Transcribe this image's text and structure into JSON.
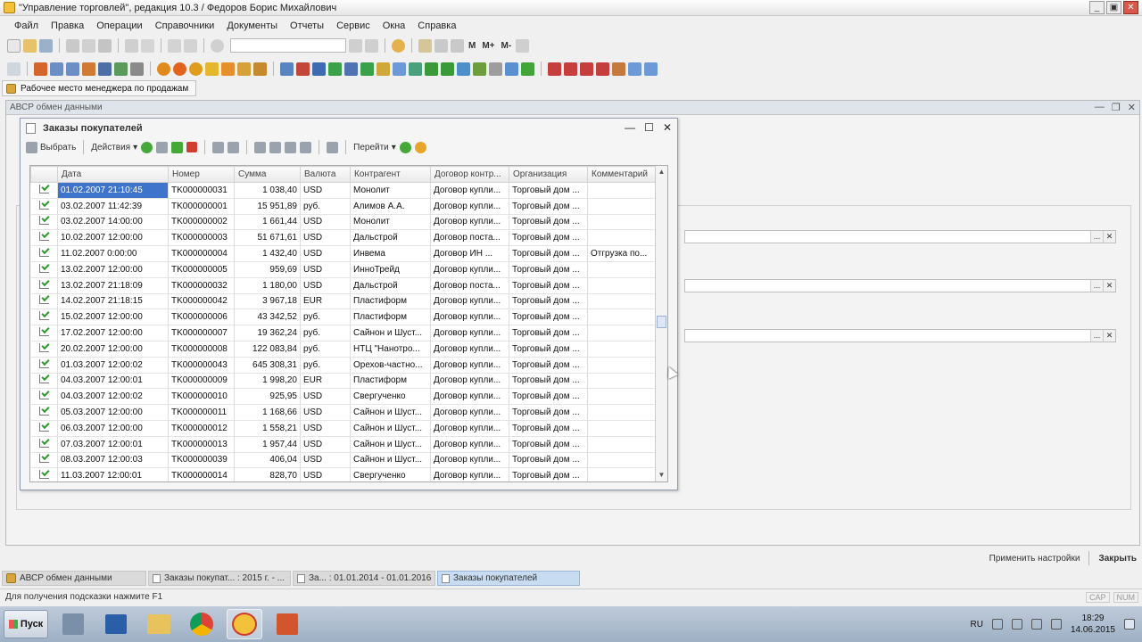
{
  "window": {
    "title": "\"Управление торговлей\", редакция 10.3 / Федоров Борис Михайлович",
    "minimize": "_",
    "maximize": "▣",
    "close": "✕"
  },
  "menu": [
    "Файл",
    "Правка",
    "Операции",
    "Справочники",
    "Документы",
    "Отчеты",
    "Сервис",
    "Окна",
    "Справка"
  ],
  "toolbar_labels": {
    "m": "M",
    "m_plus": "M+",
    "m_minus": "M-"
  },
  "workplace": {
    "label": "Рабочее место менеджера по продажам"
  },
  "bg_window": {
    "title": "АВСР обмен данными",
    "min": "—",
    "max": "❐",
    "close": "✕"
  },
  "dialog": {
    "title": "Заказы покупателей",
    "min": "—",
    "max": "☐",
    "close": "✕",
    "toolbar": {
      "select": "Выбрать",
      "actions": "Действия",
      "goto": "Перейти"
    }
  },
  "table": {
    "columns": [
      "Дата",
      "Номер",
      "Сумма",
      "Валюта",
      "Контрагент",
      "Договор контр...",
      "Организация",
      "Комментарий"
    ],
    "rows": [
      [
        "01.02.2007 21:10:45",
        "TK000000031",
        "1 038,40",
        "USD",
        "Монолит",
        "Договор купли...",
        "Торговый дом ...",
        ""
      ],
      [
        "03.02.2007 11:42:39",
        "TK000000001",
        "15 951,89",
        "руб.",
        "Алимов А.А.",
        "Договор купли...",
        "Торговый дом ...",
        ""
      ],
      [
        "03.02.2007 14:00:00",
        "TK000000002",
        "1 661,44",
        "USD",
        "Монолит",
        "Договор купли...",
        "Торговый дом ...",
        ""
      ],
      [
        "10.02.2007 12:00:00",
        "TK000000003",
        "51 671,61",
        "USD",
        "Дальстрой",
        "Договор поста...",
        "Торговый дом ...",
        ""
      ],
      [
        "11.02.2007 0:00:00",
        "TK000000004",
        "1 432,40",
        "USD",
        "Инвема",
        "Договор ИН ...",
        "Торговый дом ...",
        "Отгрузка по..."
      ],
      [
        "13.02.2007 12:00:00",
        "TK000000005",
        "959,69",
        "USD",
        "ИнноТрейд",
        "Договор купли...",
        "Торговый дом ...",
        ""
      ],
      [
        "13.02.2007 21:18:09",
        "TK000000032",
        "1 180,00",
        "USD",
        "Дальстрой",
        "Договор поста...",
        "Торговый дом ...",
        ""
      ],
      [
        "14.02.2007 21:18:15",
        "TK000000042",
        "3 967,18",
        "EUR",
        "Пластиформ",
        "Договор купли...",
        "Торговый дом ...",
        ""
      ],
      [
        "15.02.2007 12:00:00",
        "TK000000006",
        "43 342,52",
        "руб.",
        "Пластиформ",
        "Договор купли...",
        "Торговый дом ...",
        ""
      ],
      [
        "17.02.2007 12:00:00",
        "TK000000007",
        "19 362,24",
        "руб.",
        "Сайнон и Шуст...",
        "Договор купли...",
        "Торговый дом ...",
        ""
      ],
      [
        "20.02.2007 12:00:00",
        "TK000000008",
        "122 083,84",
        "руб.",
        "НТЦ \"Нанотро...",
        "Договор купли...",
        "Торговый дом ...",
        ""
      ],
      [
        "01.03.2007 12:00:02",
        "TK000000043",
        "645 308,31",
        "руб.",
        "Орехов-частно...",
        "Договор купли...",
        "Торговый дом ...",
        ""
      ],
      [
        "04.03.2007 12:00:01",
        "TK000000009",
        "1 998,20",
        "EUR",
        "Пластиформ",
        "Договор купли...",
        "Торговый дом ...",
        ""
      ],
      [
        "04.03.2007 12:00:02",
        "TK000000010",
        "925,95",
        "USD",
        "Свергученко",
        "Договор купли...",
        "Торговый дом ...",
        ""
      ],
      [
        "05.03.2007 12:00:00",
        "TK000000011",
        "1 168,66",
        "USD",
        "Сайнон и Шуст...",
        "Договор купли...",
        "Торговый дом ...",
        ""
      ],
      [
        "06.03.2007 12:00:00",
        "TK000000012",
        "1 558,21",
        "USD",
        "Сайнон и Шуст...",
        "Договор купли...",
        "Торговый дом ...",
        ""
      ],
      [
        "07.03.2007 12:00:01",
        "TK000000013",
        "1 957,44",
        "USD",
        "Сайнон и Шуст...",
        "Договор купли...",
        "Торговый дом ...",
        ""
      ],
      [
        "08.03.2007 12:00:03",
        "TK000000039",
        "406,04",
        "USD",
        "Сайнон и Шуст...",
        "Договор купли...",
        "Торговый дом ...",
        ""
      ],
      [
        "11.03.2007 12:00:01",
        "TK000000014",
        "828,70",
        "USD",
        "Свергученко",
        "Договор купли...",
        "Торговый дом ...",
        ""
      ]
    ]
  },
  "apply_bar": {
    "apply": "Применить настройки",
    "close": "Закрыть"
  },
  "open_windows": [
    {
      "label": "АВСР обмен данными"
    },
    {
      "label": "Заказы покупат... : 2015 г. - ..."
    },
    {
      "label": "За... : 01.01.2014 - 01.01.2016"
    },
    {
      "label": "Заказы покупателей"
    }
  ],
  "status": {
    "hint": "Для получения подсказки нажмите F1",
    "cap": "CAP",
    "num": "NUM"
  },
  "taskbar": {
    "start": "Пуск",
    "lang": "RU",
    "time": "18:29",
    "date": "14.06.2015"
  },
  "colors": {
    "selection": "#3e74c9",
    "active_task": "#c7dbf1",
    "titlebar_close": "#d9584c"
  }
}
